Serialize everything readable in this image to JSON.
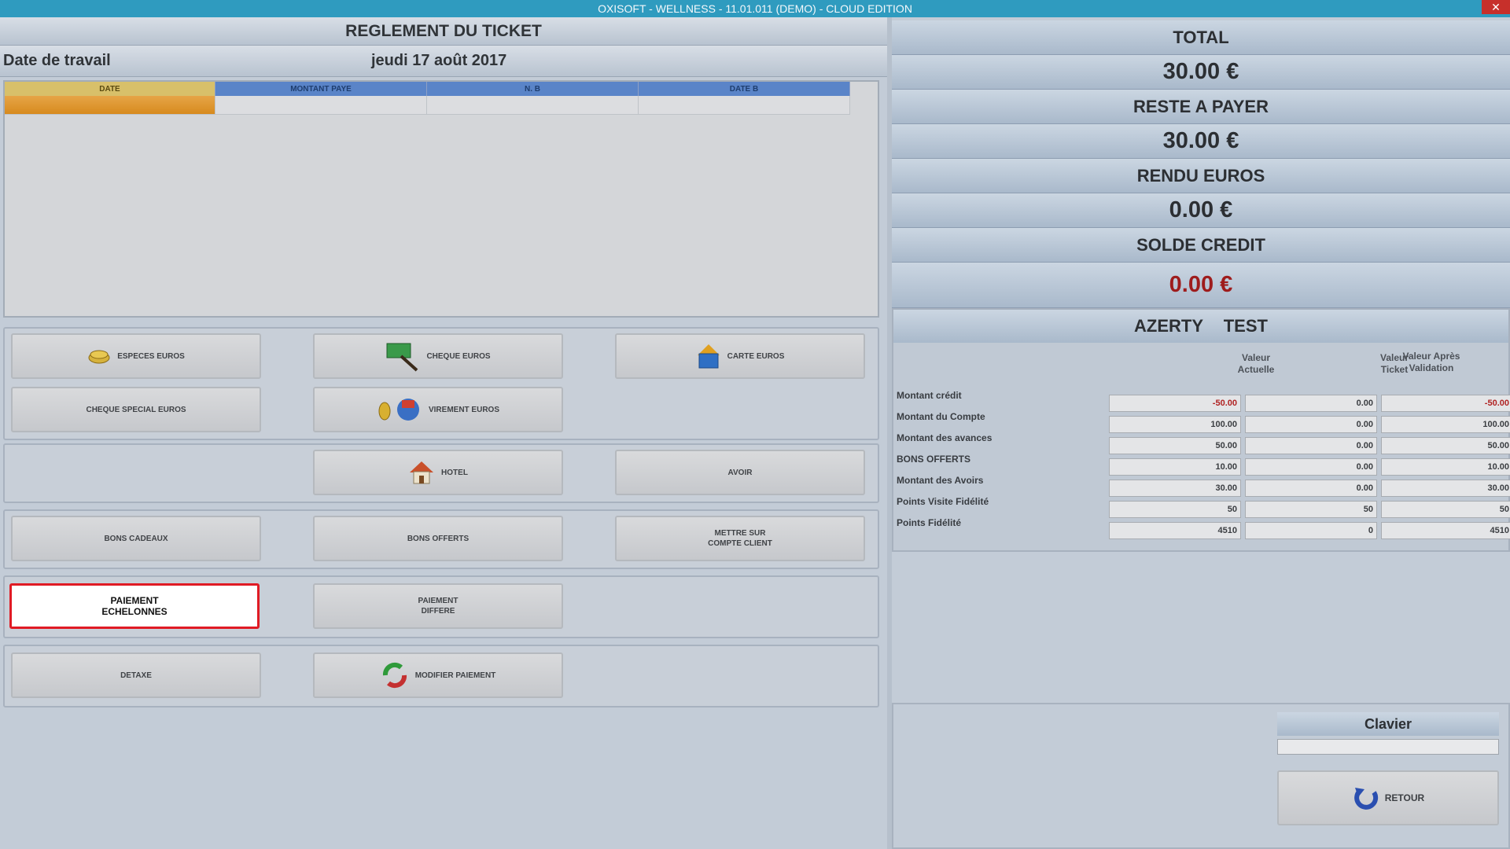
{
  "window": {
    "title": "OXISOFT - WELLNESS - 11.01.011 (DEMO) - CLOUD EDITION",
    "close": "✕"
  },
  "header": {
    "title": "REGLEMENT DU TICKET",
    "date_label": "Date de travail",
    "date_value": "jeudi 17 août 2017"
  },
  "grid": {
    "columns": [
      "DATE",
      "MONTANT PAYE",
      "N. B",
      "DATE B"
    ]
  },
  "payment_buttons": {
    "especes": "ESPECES EUROS",
    "cheque": "CHEQUE EUROS",
    "carte": "CARTE EUROS",
    "cheque_special": "CHEQUE SPECIAL EUROS",
    "virement": "VIREMENT EUROS",
    "hotel": "HOTEL",
    "avoir": "AVOIR",
    "bons_cadeaux": "BONS CADEAUX",
    "bons_offerts": "BONS OFFERTS",
    "compte_client": "METTRE SUR\nCOMPTE CLIENT",
    "paiement_echelonnes": "PAIEMENT\nECHELONNES",
    "paiement_differe": "PAIEMENT\nDIFFERE",
    "detaxe": "DETAXE",
    "modifier_paiement": "MODIFIER PAIEMENT"
  },
  "summary": {
    "total_label": "TOTAL",
    "total_value": "30.00 €",
    "reste_label": "RESTE A PAYER",
    "reste_value": "30.00 €",
    "rendu_label": "RENDU EUROS",
    "rendu_value": "0.00 €",
    "solde_label": "SOLDE CREDIT",
    "solde_value": "0.00 €"
  },
  "client": {
    "name": "AZERTY TEST",
    "col_headers": [
      "Valeur\nActuelle",
      "Valeur\nTicket",
      "Valeur Après\nValidation"
    ],
    "rows": [
      {
        "label": "Montant crédit",
        "values": [
          "-50.00",
          "0.00",
          "-50.00"
        ]
      },
      {
        "label": "Montant du Compte",
        "values": [
          "100.00",
          "0.00",
          "100.00"
        ]
      },
      {
        "label": "Montant des avances",
        "values": [
          "50.00",
          "0.00",
          "50.00"
        ]
      },
      {
        "label": "BONS OFFERTS",
        "values": [
          "10.00",
          "0.00",
          "10.00"
        ]
      },
      {
        "label": "Montant des Avoirs",
        "values": [
          "30.00",
          "0.00",
          "30.00"
        ]
      },
      {
        "label": "Points Visite Fidélité",
        "values": [
          "50",
          "50",
          "50"
        ]
      },
      {
        "label": "Points Fidélité",
        "values": [
          "4510",
          "0",
          "4510"
        ]
      }
    ]
  },
  "keyboard": {
    "label": "Clavier",
    "retour": "RETOUR"
  },
  "colors": {
    "accent_red": "#e01b24",
    "titlebar": "#2f9bbf",
    "credit_red": "#9e1c1c"
  }
}
